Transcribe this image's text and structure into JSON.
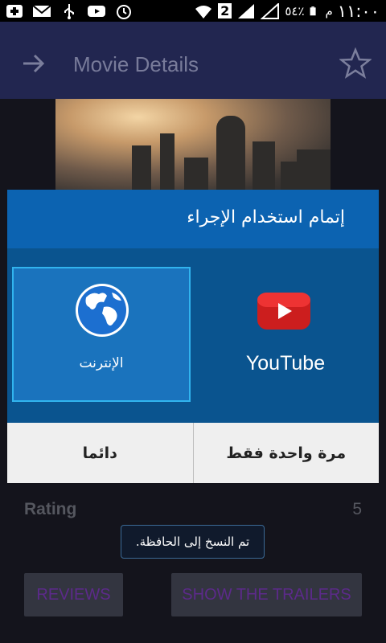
{
  "status_bar": {
    "time": "١١:٠٠",
    "ampm": "م",
    "battery_percent": "٥٤٪",
    "sim_badge": "2",
    "left_icons": [
      "add-icon",
      "email-icon",
      "usb-icon",
      "youtube-icon",
      "alarm-icon"
    ],
    "right_icons": [
      "wifi-icon",
      "signal-icon",
      "signal-icon",
      "battery-icon"
    ]
  },
  "app_bar": {
    "title": "Movie Details",
    "color": "#222650"
  },
  "dialog": {
    "title": "إتمام استخدام الإجراء",
    "apps": [
      {
        "label": "الإنترنت",
        "icon": "globe-icon",
        "selected": true
      },
      {
        "label": "YouTube",
        "icon": "youtube-play-icon",
        "selected": false
      }
    ],
    "buttons": {
      "always": "دائما",
      "just_once": "مرة واحدة فقط"
    }
  },
  "details": {
    "rating_label": "Rating",
    "rating_value": "5"
  },
  "toast": {
    "text": "تم النسخ إلى الحافظة."
  },
  "actions": {
    "reviews": "REVIEWS",
    "trailers": "SHOW THE TRAILERS"
  }
}
